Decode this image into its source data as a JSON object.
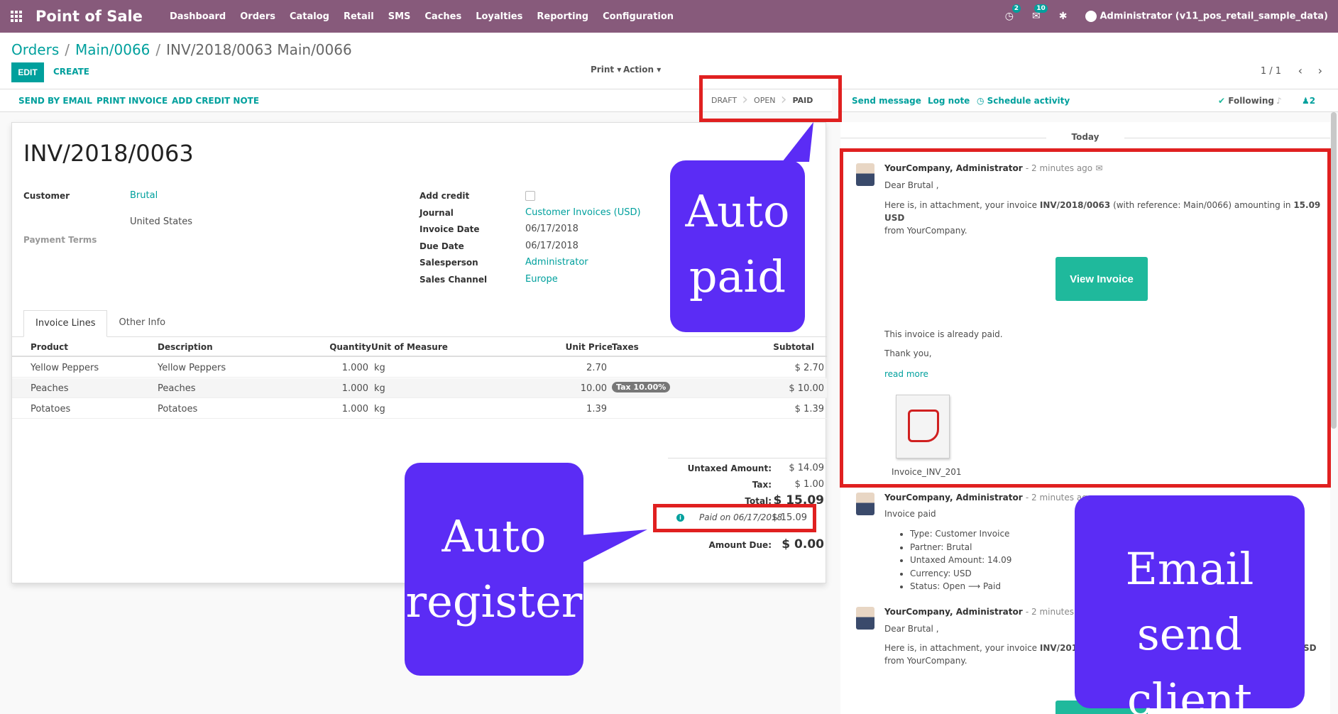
{
  "navbar": {
    "brand": "Point of Sale",
    "menu": [
      "Dashboard",
      "Orders",
      "Catalog",
      "Retail",
      "SMS",
      "Caches",
      "Loyalties",
      "Reporting",
      "Configuration"
    ],
    "activities_badge": "2",
    "messages_badge": "10",
    "user": "Administrator (v11_pos_retail_sample_data)",
    "color": "#875a7b"
  },
  "breadcrumb": {
    "orders": "Orders",
    "order": "Main/0066",
    "current": "INV/2018/0063 Main/0066"
  },
  "control": {
    "edit": "EDIT",
    "create": "CREATE",
    "print": "Print ▾",
    "action": "Action ▾",
    "pager": "1 / 1"
  },
  "statusbar": {
    "buttons": [
      "SEND BY EMAIL",
      "PRINT INVOICE",
      "ADD CREDIT NOTE"
    ],
    "steps": [
      "DRAFT",
      "OPEN",
      "PAID"
    ],
    "active_step": "PAID"
  },
  "chatter_head": {
    "send": "Send message",
    "log": "Log note",
    "schedule": "Schedule activity",
    "following": "Following",
    "followers": "2"
  },
  "invoice": {
    "number": "INV/2018/0063",
    "customer_label": "Customer",
    "customer": "Brutal",
    "address": "United States",
    "payment_terms_label": "Payment Terms",
    "fields": [
      {
        "label": "Add credit",
        "value": ""
      },
      {
        "label": "Journal",
        "value": "Customer Invoices (USD)"
      },
      {
        "label": "Invoice Date",
        "value": "06/17/2018"
      },
      {
        "label": "Due Date",
        "value": "06/17/2018"
      },
      {
        "label": "Salesperson",
        "value": "Administrator"
      },
      {
        "label": "Sales Channel",
        "value": "Europe"
      }
    ],
    "tabs": [
      "Invoice Lines",
      "Other Info"
    ],
    "columns": [
      "Product",
      "Description",
      "Quantity",
      "Unit of Measure",
      "Unit Price",
      "Taxes",
      "Subtotal"
    ],
    "lines": [
      {
        "product": "Yellow Peppers",
        "description": "Yellow Peppers",
        "qty": "1.000",
        "uom": "kg",
        "price": "2.70",
        "tax": "",
        "subtotal": "$ 2.70"
      },
      {
        "product": "Peaches",
        "description": "Peaches",
        "qty": "1.000",
        "uom": "kg",
        "price": "10.00",
        "tax": "Tax 10.00%",
        "subtotal": "$ 10.00"
      },
      {
        "product": "Potatoes",
        "description": "Potatoes",
        "qty": "1.000",
        "uom": "kg",
        "price": "1.39",
        "tax": "",
        "subtotal": "$ 1.39"
      }
    ],
    "totals": {
      "untaxed_label": "Untaxed Amount:",
      "untaxed": "$ 14.09",
      "tax_label": "Tax:",
      "tax": "$ 1.00",
      "total_label": "Total:",
      "total": "$ 15.09",
      "paid_text": "Paid on 06/17/2018",
      "paid_amount": "$ 15.09",
      "due_label": "Amount Due:",
      "due": "$ 0.00"
    }
  },
  "chatter": {
    "day": "Today",
    "messages": [
      {
        "author": "YourCompany, Administrator",
        "date": "- 2 minutes ago",
        "greeting": "Dear Brutal ,",
        "body_pre": "Here is, in attachment, your invoice ",
        "body_ref": "INV/2018/0063",
        "body_mid": " (with reference: Main/0066) amounting in ",
        "body_amt": "15.09 USD",
        "body_post": "from YourCompany.",
        "button": "View Invoice",
        "paid_note": "This invoice is already paid.",
        "thanks": "Thank you,",
        "read_more": "read more",
        "attachment": "Invoice_INV_201"
      },
      {
        "author": "YourCompany, Administrator",
        "date": "- 2 minutes ago",
        "subtype": "Invoice paid",
        "tracking": [
          "Type: Customer Invoice",
          "Partner: Brutal",
          "Untaxed Amount: 14.09",
          "Currency: USD",
          "Status: Open ⟶ Paid"
        ]
      },
      {
        "author": "YourCompany, Administrator",
        "date": "- 2 minutes ago",
        "greeting": "Dear Brutal ,",
        "body_pre": "Here is, in attachment, your invoice ",
        "body_ref": "INV/2018/",
        "body_tail": "SD",
        "body_post": "from YourCompany."
      }
    ]
  },
  "callouts": {
    "auto_paid": [
      "Auto",
      "paid"
    ],
    "auto_register": [
      "Auto",
      "register"
    ],
    "email": [
      "Email",
      "send client"
    ],
    "color": "#5b2cf5",
    "frame_color": "#e02020"
  }
}
